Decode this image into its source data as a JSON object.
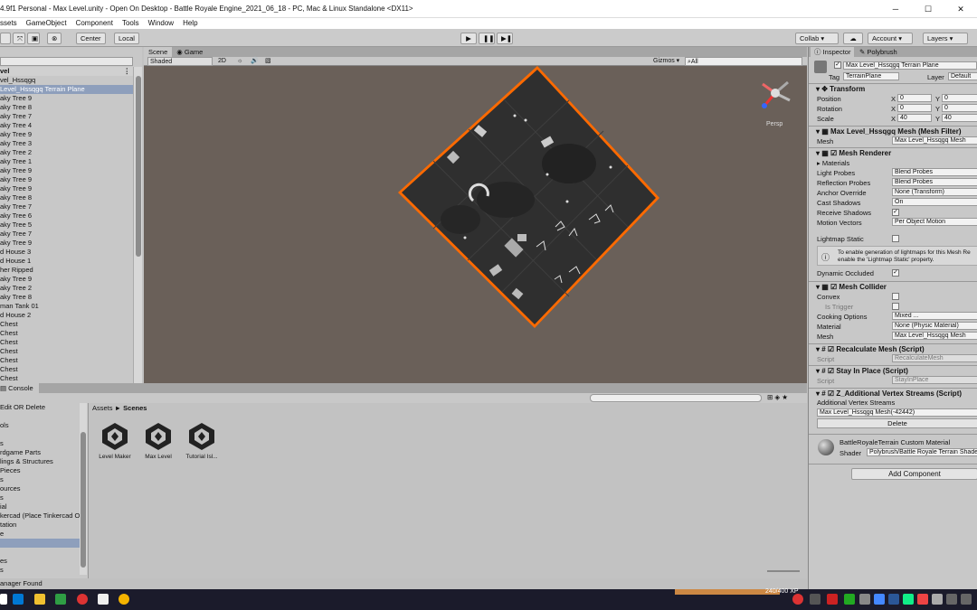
{
  "window": {
    "title": "4.9f1 Personal - Max Level.unity - Open On Desktop - Battle Royale Engine_2021_06_18 - PC, Mac & Linux Standalone <DX11>"
  },
  "menu": [
    "ssets",
    "GameObject",
    "Component",
    "Tools",
    "Window",
    "Help"
  ],
  "toolbar": {
    "center": "Center",
    "local": "Local",
    "collab": "Collab",
    "account": "Account",
    "layers": "Layers"
  },
  "hierarchy": {
    "scene_name": "vel",
    "items": [
      "vel_Hssqgq",
      "Level_Hssqgq Terrain Plane",
      "aky Tree 9",
      "aky Tree 8",
      "aky Tree 7",
      "aky Tree 4",
      "aky Tree 9",
      "aky Tree 3",
      "aky Tree 2",
      "aky Tree 1",
      "aky Tree 9",
      "aky Tree 9",
      "aky Tree 9",
      "aky Tree 8",
      "aky Tree 7",
      "aky Tree 6",
      "aky Tree 5",
      "aky Tree 7",
      "aky Tree 9",
      "d House 3",
      "d House 1",
      "her Ripped",
      "aky Tree 9",
      "aky Tree 2",
      "aky Tree 8",
      "man Tank 01",
      "d House 2",
      "Chest",
      "Chest",
      "Chest",
      "Chest",
      "Chest",
      "Chest",
      "Chest"
    ]
  },
  "scene": {
    "tab_scene": "Scene",
    "tab_game": "Game",
    "shading": "Shaded",
    "mode_2d": "2D",
    "gizmos": "Gizmos",
    "search_placeholder": "All",
    "persp": "Persp"
  },
  "console_tab": "Console",
  "project": {
    "left_items": [
      " Edit OR Delete",
      "",
      "ols",
      "",
      "s",
      "rdgame Parts",
      "lings & Structures",
      " Pieces",
      "s",
      "ources",
      "s",
      "ial",
      "kercad (Place Tinkercad O",
      "tation",
      "e",
      "",
      "",
      "es",
      "s"
    ],
    "breadcrumb_root": "Assets",
    "breadcrumb_sep": "►",
    "breadcrumb_leaf": "Scenes",
    "assets": [
      "Level Maker",
      "Max Level",
      "Tutorial Isl..."
    ],
    "status": "anager Found"
  },
  "inspector": {
    "tab_inspector": "Inspector",
    "tab_polybrush": "Polybrush",
    "object_name": "Max Level_Hssqgq Terrain Plane",
    "tag_label": "Tag",
    "tag_value": "TerrainPlane",
    "layer_label": "Layer",
    "layer_value": "Default",
    "transform": {
      "title": "Transform",
      "position_label": "Position",
      "rotation_label": "Rotation",
      "scale_label": "Scale",
      "x": "X",
      "y": "Y",
      "pos_x": "0",
      "pos_y": "0",
      "rot_x": "0",
      "rot_y": "0",
      "scale_x": "40",
      "scale_y": "40"
    },
    "mesh_filter": {
      "title": "Max Level_Hssqgq Mesh (Mesh Filter)",
      "mesh_label": "Mesh",
      "mesh_value": "Max Level_Hssqgq Mesh"
    },
    "mesh_renderer": {
      "title": "Mesh Renderer",
      "materials_label": "Materials",
      "light_probes_label": "Light Probes",
      "light_probes_value": "Blend Probes",
      "reflection_probes_label": "Reflection Probes",
      "reflection_probes_value": "Blend Probes",
      "anchor_override_label": "Anchor Override",
      "anchor_override_value": "None (Transform)",
      "cast_shadows_label": "Cast Shadows",
      "cast_shadows_value": "On",
      "receive_shadows_label": "Receive Shadows",
      "motion_vectors_label": "Motion Vectors",
      "motion_vectors_value": "Per Object Motion",
      "lightmap_static_label": "Lightmap Static",
      "help_line1": "To enable generation of lightmaps for this Mesh Re",
      "help_line2": "enable the 'Lightmap Static' property.",
      "dynamic_occluded_label": "Dynamic Occluded"
    },
    "mesh_collider": {
      "title": "Mesh Collider",
      "convex_label": "Convex",
      "is_trigger_label": "Is Trigger",
      "cooking_label": "Cooking Options",
      "cooking_value": "Mixed ...",
      "material_label": "Material",
      "material_value": "None (Physic Material)",
      "mesh_label": "Mesh",
      "mesh_value": "Max Level_Hssqgq Mesh"
    },
    "recalc": {
      "title": "Recalculate Mesh (Script)",
      "script_label": "Script",
      "script_value": "RecalculateMesh"
    },
    "stay": {
      "title": "Stay In Place (Script)",
      "script_label": "Script",
      "script_value": "StayInPlace"
    },
    "zadd": {
      "title": "Z_Additional Vertex Streams (Script)",
      "streams_label": "Additional Vertex Streams",
      "stream_value": "Max Level_Hssqgq Mesh(-42442)",
      "delete_label": "Delete"
    },
    "material": {
      "name": "BattleRoyaleTerrain Custom Material",
      "shader_label": "Shader",
      "shader_value": "Polybrush/Battle Royale Terrain Shade"
    },
    "add_component": "Add Component"
  },
  "taskbar": {
    "xp_label": "240/400 XP"
  }
}
